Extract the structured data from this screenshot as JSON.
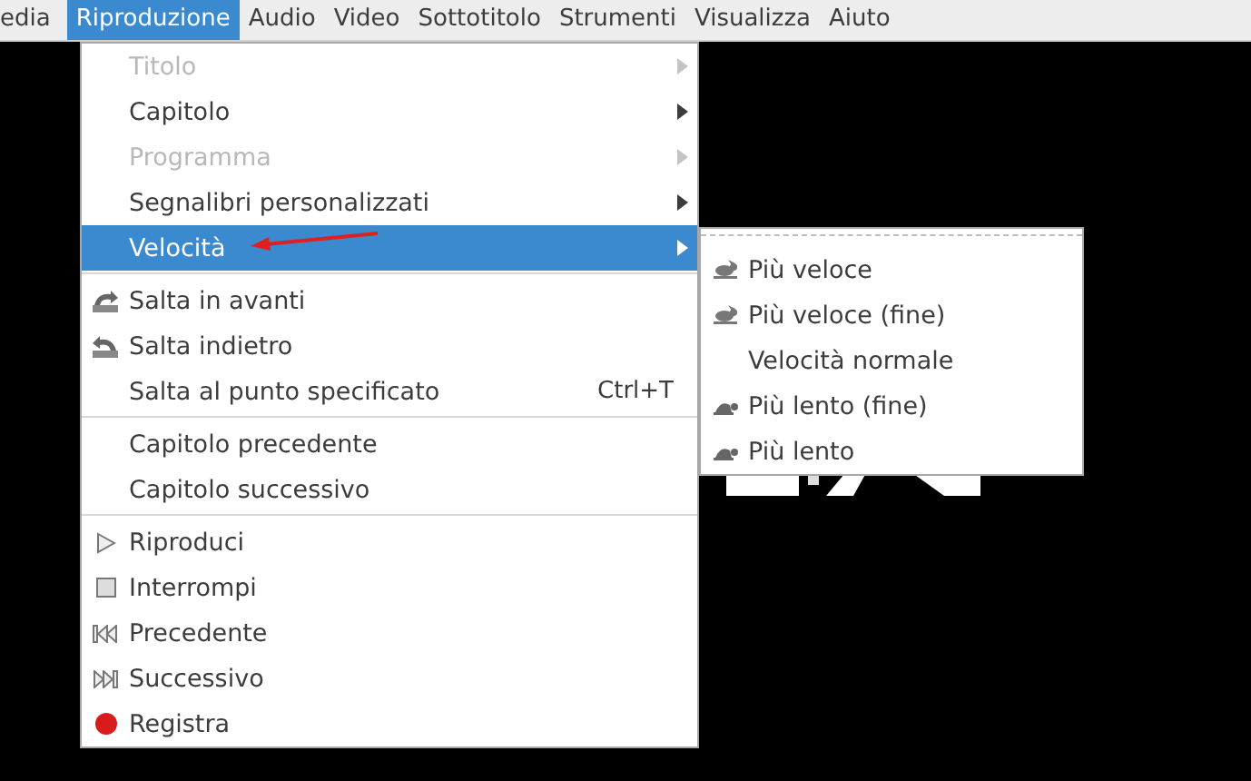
{
  "menubar": [
    {
      "label": "edia",
      "selected": false
    },
    {
      "label": "Riproduzione",
      "selected": true
    },
    {
      "label": "Audio",
      "selected": false
    },
    {
      "label": "Video",
      "selected": false
    },
    {
      "label": "Sottotitolo",
      "selected": false
    },
    {
      "label": "Strumenti",
      "selected": false
    },
    {
      "label": "Visualizza",
      "selected": false
    },
    {
      "label": "Aiuto",
      "selected": false
    }
  ],
  "menu": {
    "items": [
      {
        "kind": "item",
        "label": "Titolo",
        "disabled": true,
        "selected": false,
        "submenu": true
      },
      {
        "kind": "item",
        "label": "Capitolo",
        "disabled": false,
        "selected": false,
        "submenu": true
      },
      {
        "kind": "item",
        "label": "Programma",
        "disabled": true,
        "selected": false,
        "submenu": true
      },
      {
        "kind": "item",
        "label": "Segnalibri personalizzati",
        "disabled": false,
        "selected": false,
        "submenu": true
      },
      {
        "kind": "item",
        "label": "Velocità",
        "disabled": false,
        "selected": true,
        "submenu": true
      },
      {
        "kind": "separator"
      },
      {
        "kind": "item",
        "label": "Salta in avanti",
        "disabled": false,
        "selected": false
      },
      {
        "kind": "item",
        "label": "Salta indietro",
        "disabled": false,
        "selected": false
      },
      {
        "kind": "item",
        "label": "Salta al punto specificato",
        "disabled": false,
        "selected": false,
        "shortcut": "Ctrl+T"
      },
      {
        "kind": "separator"
      },
      {
        "kind": "item",
        "label": "Capitolo precedente",
        "disabled": false,
        "selected": false
      },
      {
        "kind": "item",
        "label": "Capitolo successivo",
        "disabled": false,
        "selected": false
      },
      {
        "kind": "separator"
      },
      {
        "kind": "item",
        "label": "Riproduci",
        "disabled": false,
        "selected": false
      },
      {
        "kind": "item",
        "label": "Interrompi",
        "disabled": false,
        "selected": false
      },
      {
        "kind": "item",
        "label": "Precedente",
        "disabled": false,
        "selected": false
      },
      {
        "kind": "item",
        "label": "Successivo",
        "disabled": false,
        "selected": false
      },
      {
        "kind": "item",
        "label": "Registra",
        "disabled": false,
        "selected": false
      }
    ]
  },
  "submenu": {
    "items": [
      {
        "label": "Più veloce"
      },
      {
        "label": "Più veloce (fine)"
      },
      {
        "label": "Velocità normale"
      },
      {
        "label": "Più lento (fine)"
      },
      {
        "label": "Più lento"
      }
    ]
  }
}
